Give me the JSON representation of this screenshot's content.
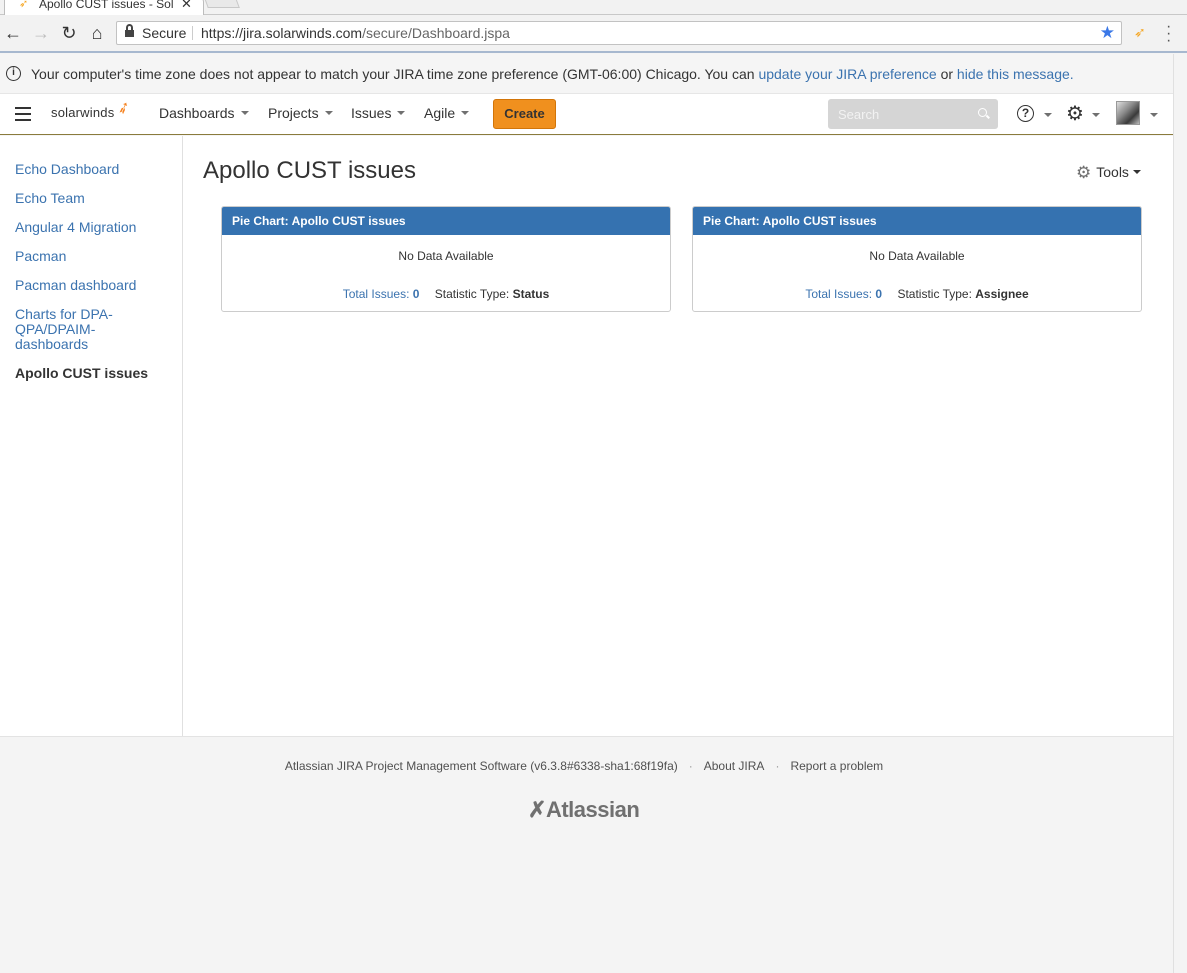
{
  "browser": {
    "tab_title": "Apollo CUST issues - Sol",
    "secure_label": "Secure",
    "url_base": "https://jira.solarwinds.com",
    "url_path": "/secure/Dashboard.jspa"
  },
  "tz_message": {
    "text": "Your computer's time zone does not appear to match your JIRA time zone preference (GMT-06:00) Chicago. You can ",
    "link1": "update your JIRA preference",
    "or": " or ",
    "link2": "hide this message."
  },
  "header": {
    "logo": "solarwinds",
    "nav": {
      "dashboards": "Dashboards",
      "projects": "Projects",
      "issues": "Issues",
      "agile": "Agile"
    },
    "create_label": "Create",
    "search_placeholder": "Search"
  },
  "sidebar": {
    "items": [
      {
        "label": "Echo Dashboard"
      },
      {
        "label": "Echo Team"
      },
      {
        "label": "Angular 4 Migration"
      },
      {
        "label": "Pacman"
      },
      {
        "label": "Pacman dashboard"
      },
      {
        "label": "Charts for DPA-QPA/DPAIM-dashboards"
      },
      {
        "label": "Apollo CUST issues"
      }
    ]
  },
  "main": {
    "title": "Apollo CUST issues",
    "tools_label": "Tools",
    "gadgets": [
      {
        "title": "Pie Chart: Apollo CUST issues",
        "no_data": "No Data Available",
        "total_label": "Total Issues:",
        "total_value": "0",
        "stat_label": "Statistic Type:",
        "stat_value": "Status"
      },
      {
        "title": "Pie Chart: Apollo CUST issues",
        "no_data": "No Data Available",
        "total_label": "Total Issues:",
        "total_value": "0",
        "stat_label": "Statistic Type:",
        "stat_value": "Assignee"
      }
    ]
  },
  "footer": {
    "software": "Atlassian JIRA Project Management Software (v6.3.8#6338-sha1:68f19fa)",
    "about": "About JIRA",
    "report": "Report a problem",
    "logo": "Atlassian"
  },
  "colors": {
    "link": "#3b73af",
    "gadget_header": "#3572b0",
    "create_button": "#f0901e"
  }
}
